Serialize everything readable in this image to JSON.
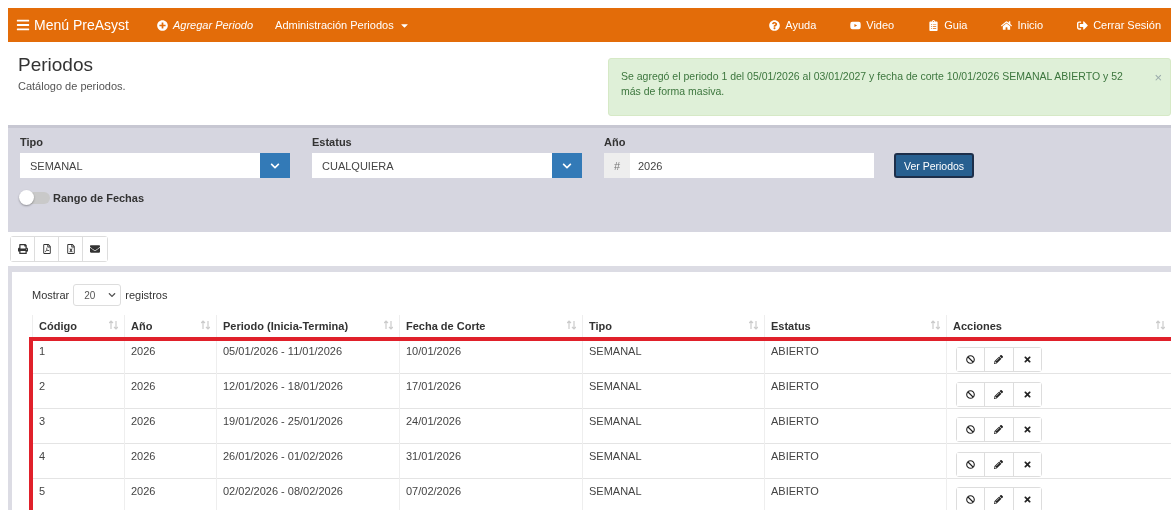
{
  "navbar": {
    "brand": "Menú PreAsyst",
    "left_items": [
      {
        "kind": "add",
        "label": "Agregar Periodo"
      },
      {
        "kind": "dropdown",
        "label": "Administración Periodos"
      }
    ],
    "right_items": [
      {
        "kind": "help",
        "label": "Ayuda"
      },
      {
        "kind": "video",
        "label": "Video"
      },
      {
        "kind": "guide",
        "label": "Guia"
      },
      {
        "kind": "home",
        "label": "Inicio"
      },
      {
        "kind": "logout",
        "label": "Cerrar Sesión"
      }
    ]
  },
  "header": {
    "title": "Periodos",
    "subtitle": "Catálogo de periodos."
  },
  "alert": {
    "message": "Se agregó el periodo 1 del 05/01/2026 al 03/01/2027 y fecha de corte 10/01/2026 SEMANAL ABIERTO y 52 más de forma masiva.",
    "close": "×"
  },
  "filters": {
    "tipo": {
      "label": "Tipo",
      "value": "SEMANAL"
    },
    "estatus": {
      "label": "Estatus",
      "value": "CUALQUIERA"
    },
    "anio": {
      "label": "Año",
      "prefix": "#",
      "value": "2026"
    },
    "submit": "Ver Periodos",
    "range_toggle": {
      "label": "Rango de Fechas",
      "on": false
    }
  },
  "table": {
    "length_label_before": "Mostrar",
    "length_value": "20",
    "length_label_after": "registros",
    "highlighted": true,
    "columns": [
      "Código",
      "Año",
      "Periodo (Inicia-Termina)",
      "Fecha de Corte",
      "Tipo",
      "Estatus",
      "Acciones"
    ],
    "rows": [
      {
        "cells": [
          "1",
          "2026",
          "05/01/2026 - 11/01/2026",
          "10/01/2026",
          "SEMANAL",
          "ABIERTO"
        ]
      },
      {
        "cells": [
          "2",
          "2026",
          "12/01/2026 - 18/01/2026",
          "17/01/2026",
          "SEMANAL",
          "ABIERTO"
        ]
      },
      {
        "cells": [
          "3",
          "2026",
          "19/01/2026 - 25/01/2026",
          "24/01/2026",
          "SEMANAL",
          "ABIERTO"
        ]
      },
      {
        "cells": [
          "4",
          "2026",
          "26/01/2026 - 01/02/2026",
          "31/01/2026",
          "SEMANAL",
          "ABIERTO"
        ]
      },
      {
        "cells": [
          "5",
          "2026",
          "02/02/2026 - 08/02/2026",
          "07/02/2026",
          "SEMANAL",
          "ABIERTO"
        ]
      }
    ]
  }
}
